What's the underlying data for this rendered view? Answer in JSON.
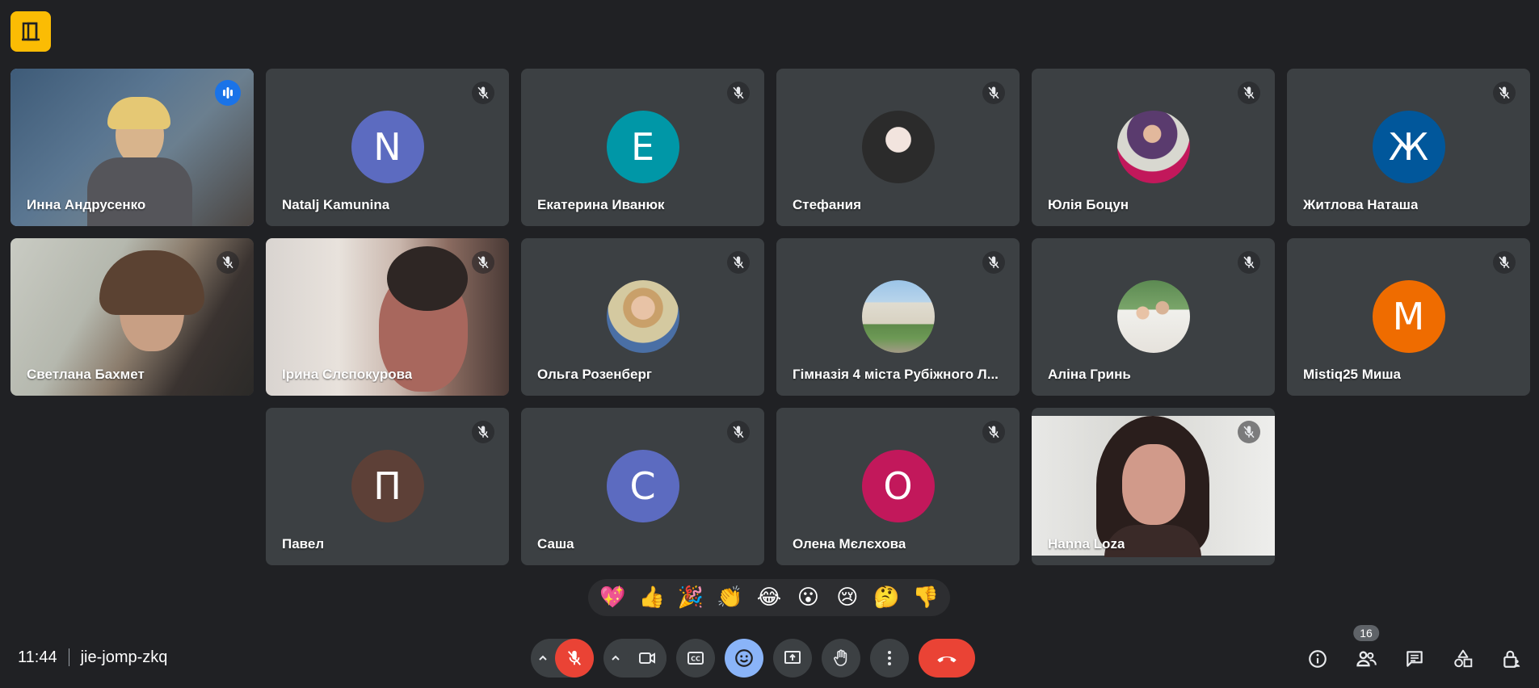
{
  "meeting": {
    "time": "11:44",
    "code": "jie-jomp-zkq",
    "participant_count": "16"
  },
  "participants": [
    {
      "name": "Инна Андрусенко",
      "type": "video",
      "speaking": true
    },
    {
      "name": "Natalj Kamunina",
      "type": "initial",
      "initial": "N",
      "color": "#5c6bc0",
      "muted": true
    },
    {
      "name": "Екатерина Иванюк",
      "type": "initial",
      "initial": "E",
      "color": "#0097a7",
      "muted": true
    },
    {
      "name": "Стефания",
      "type": "photo",
      "muted": true
    },
    {
      "name": "Юлія Боцун",
      "type": "photo",
      "muted": true
    },
    {
      "name": "Житлова Наташа",
      "type": "initial",
      "initial": "Ж",
      "color": "#01579b",
      "muted": true
    },
    {
      "name": "Светлана Бахмет",
      "type": "video",
      "muted": true
    },
    {
      "name": "Ірина Слєпокурова",
      "type": "video",
      "muted": true
    },
    {
      "name": "Ольга Розенберг",
      "type": "photo",
      "muted": true
    },
    {
      "name": "Гімназія 4 міста Рубіжного Л...",
      "type": "photo",
      "muted": true
    },
    {
      "name": "Аліна Гринь",
      "type": "photo",
      "muted": true
    },
    {
      "name": "Mistiq25 Миша",
      "type": "initial",
      "initial": "M",
      "color": "#ef6c00",
      "muted": true
    },
    {
      "name": "Павел",
      "type": "initial",
      "initial": "П",
      "color": "#5d4037",
      "muted": true
    },
    {
      "name": "Саша",
      "type": "initial",
      "initial": "С",
      "color": "#5c6bc0",
      "muted": true
    },
    {
      "name": "Олена Мєлєхова",
      "type": "initial",
      "initial": "O",
      "color": "#c2185b",
      "muted": true
    },
    {
      "name": "Hanna Loza",
      "type": "video",
      "muted": true
    }
  ],
  "reactions": [
    "💖",
    "👍",
    "🎉",
    "👏",
    "😂",
    "😮",
    "😢",
    "🤔",
    "👎"
  ]
}
